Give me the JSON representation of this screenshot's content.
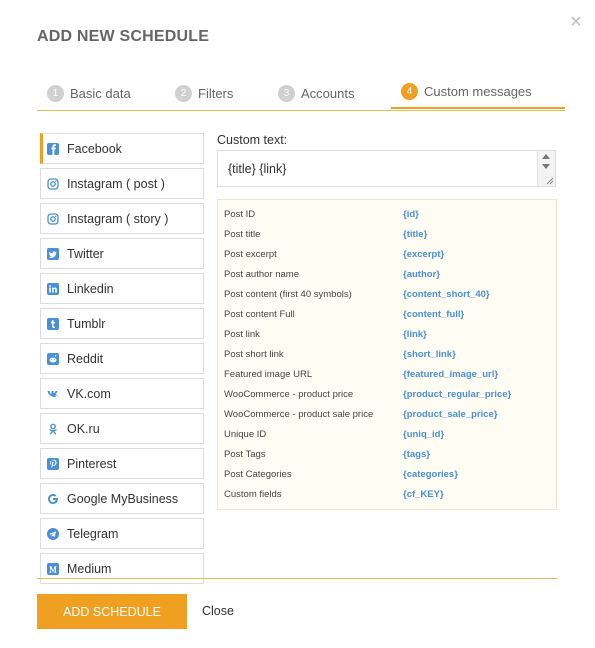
{
  "header": {
    "title": "ADD NEW SCHEDULE",
    "close": "×"
  },
  "tabs": [
    {
      "num": "1",
      "label": "Basic data"
    },
    {
      "num": "2",
      "label": "Filters"
    },
    {
      "num": "3",
      "label": "Accounts"
    },
    {
      "num": "4",
      "label": "Custom messages"
    }
  ],
  "sidebar": {
    "items": [
      {
        "label": "Facebook",
        "icon": "facebook-icon",
        "color": "#4a90d6"
      },
      {
        "label": "Instagram ( post )",
        "icon": "instagram-icon",
        "color": "#4a90d6"
      },
      {
        "label": "Instagram ( story )",
        "icon": "instagram-icon",
        "color": "#4a90d6"
      },
      {
        "label": "Twitter",
        "icon": "twitter-icon",
        "color": "#4a90d6"
      },
      {
        "label": "Linkedin",
        "icon": "linkedin-icon",
        "color": "#4a90d6"
      },
      {
        "label": "Tumblr",
        "icon": "tumblr-icon",
        "color": "#4a90d6"
      },
      {
        "label": "Reddit",
        "icon": "reddit-icon",
        "color": "#4a90d6"
      },
      {
        "label": "VK.com",
        "icon": "vk-icon",
        "color": "#4a90d6"
      },
      {
        "label": "OK.ru",
        "icon": "ok-icon",
        "color": "#4a90d6"
      },
      {
        "label": "Pinterest",
        "icon": "pinterest-icon",
        "color": "#4a90d6"
      },
      {
        "label": "Google MyBusiness",
        "icon": "google-icon",
        "color": "#4a90d6"
      },
      {
        "label": "Telegram",
        "icon": "telegram-icon",
        "color": "#4a90d6"
      },
      {
        "label": "Medium",
        "icon": "medium-icon",
        "color": "#4a90d6"
      }
    ]
  },
  "editor": {
    "label": "Custom text:",
    "value": "{title} {link}"
  },
  "variables": [
    {
      "key": "Post ID",
      "value": "{id}"
    },
    {
      "key": "Post title",
      "value": "{title}"
    },
    {
      "key": "Post excerpt",
      "value": "{excerpt}"
    },
    {
      "key": "Post author name",
      "value": "{author}"
    },
    {
      "key": "Post content (first 40 symbols)",
      "value": "{content_short_40}"
    },
    {
      "key": "Post content Full",
      "value": "{content_full}"
    },
    {
      "key": "Post link",
      "value": "{link}"
    },
    {
      "key": "Post short link",
      "value": "{short_link}"
    },
    {
      "key": "Featured image URL",
      "value": "{featured_image_url}"
    },
    {
      "key": "WooCommerce - product price",
      "value": "{product_regular_price}"
    },
    {
      "key": "WooCommerce - product sale price",
      "value": "{product_sale_price}"
    },
    {
      "key": "Unique ID",
      "value": "{uniq_id}"
    },
    {
      "key": "Post Tags",
      "value": "{tags}"
    },
    {
      "key": "Post Categories",
      "value": "{categories}"
    },
    {
      "key": "Custom fields",
      "value": "{cf_KEY}"
    }
  ],
  "footer": {
    "add_label": "ADD SCHEDULE",
    "close_label": "Close"
  },
  "colors": {
    "accent": "#f0a020",
    "link": "#4a90d6",
    "divider": "#d8c060"
  }
}
